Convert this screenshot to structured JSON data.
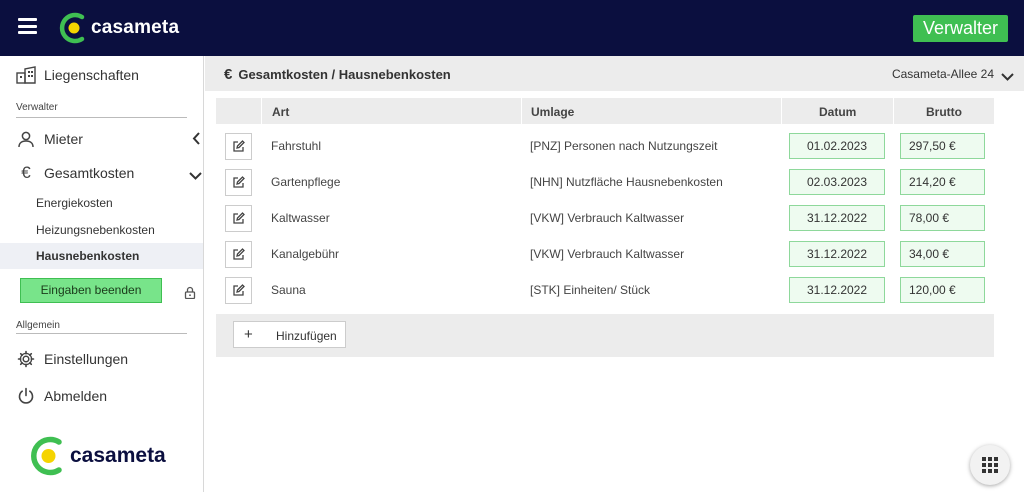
{
  "header": {
    "brand": "casameta",
    "role_badge": "Verwalter",
    "brand_colors": {
      "navy": "#0b0f3f",
      "green": "#3fbf52",
      "yellow": "#f5d400"
    }
  },
  "sidebar": {
    "properties_label": "Liegenschaften",
    "section_manager": "Verwalter",
    "tenants_label": "Mieter",
    "total_costs_label": "Gesamtkosten",
    "sub_items": [
      "Energiekosten",
      "Heizungsnebenkosten",
      "Hausnebenkosten"
    ],
    "active_sub_item": "Hausnebenkosten",
    "finish_button": "Eingaben beenden",
    "section_general": "Allgemein",
    "settings_label": "Einstellungen",
    "logout_label": "Abmelden",
    "brand": "casameta"
  },
  "subheader": {
    "title": "Gesamtkosten / Hausnebenkosten",
    "property_selected": "Casameta-Allee 24"
  },
  "table": {
    "columns": [
      "Art",
      "Umlage",
      "Datum",
      "Brutto"
    ],
    "rows": [
      {
        "art": "Fahrstuhl",
        "umlage": "[PNZ] Personen nach Nutzungszeit",
        "datum": "01.02.2023",
        "brutto": "297,50 €"
      },
      {
        "art": "Gartenpflege",
        "umlage": "[NHN] Nutzfläche Hausnebenkosten",
        "datum": "02.03.2023",
        "brutto": "214,20 €"
      },
      {
        "art": "Kaltwasser",
        "umlage": "[VKW] Verbrauch Kaltwasser",
        "datum": "31.12.2022",
        "brutto": "78,00 €"
      },
      {
        "art": "Kanalgebühr",
        "umlage": "[VKW] Verbrauch Kaltwasser",
        "datum": "31.12.2022",
        "brutto": "34,00 €"
      },
      {
        "art": "Sauna",
        "umlage": "[STK] Einheiten/ Stück",
        "datum": "31.12.2022",
        "brutto": "120,00 €"
      }
    ],
    "add_button": "Hinzufügen"
  },
  "icons": {
    "menu": "hamburger-icon",
    "edit": "edit-icon",
    "apps": "grid-icon",
    "lock": "lock-icon"
  }
}
